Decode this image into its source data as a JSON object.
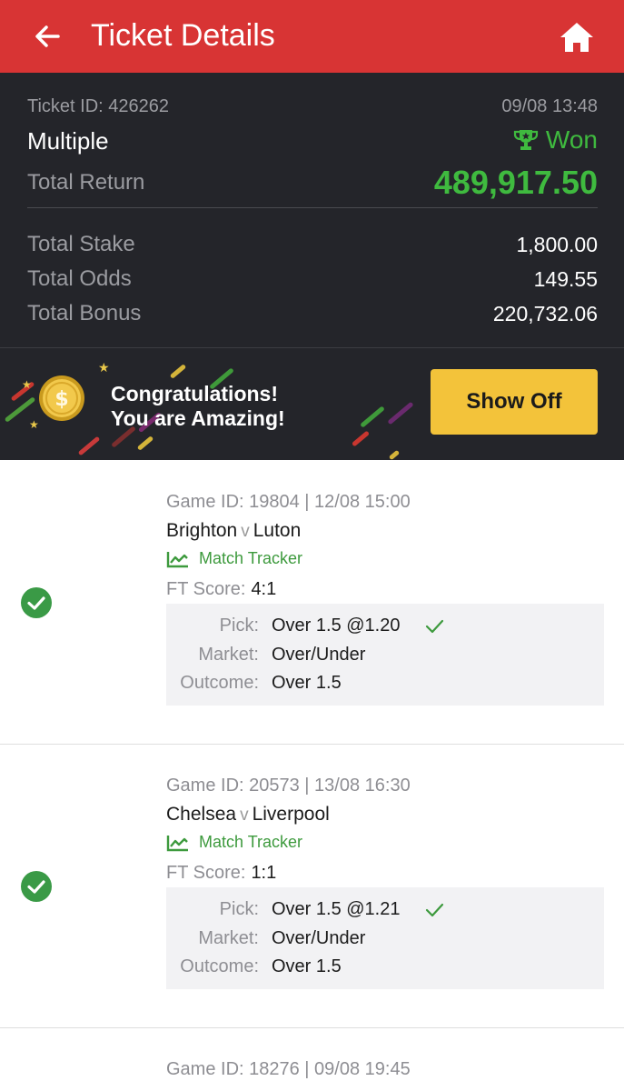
{
  "header": {
    "title": "Ticket Details",
    "back_icon": "arrow-left-icon",
    "home_icon": "home-icon",
    "color": "#d83434"
  },
  "summary": {
    "ticket_id": "Ticket ID: 426262",
    "datetime": "09/08 13:48",
    "bet_type": "Multiple",
    "status": "Won",
    "status_icon": "trophy-icon",
    "status_color": "#3fba3f",
    "total_return_label": "Total Return",
    "total_return_value": "489,917.50",
    "rows": [
      {
        "label": "Total Stake",
        "value": "1,800.00"
      },
      {
        "label": "Total Odds",
        "value": "149.55"
      },
      {
        "label": "Total Bonus",
        "value": "220,732.06"
      }
    ]
  },
  "promo": {
    "line1": "Congratulations!",
    "line2": "You are Amazing!",
    "button_label": "Show Off",
    "coin_icon": "coin-icon",
    "button_color": "#f3c33a"
  },
  "games": [
    {
      "game_id": "Game ID: 19804 | 12/08 15:00",
      "home": "Brighton",
      "vs": "v",
      "away": "Luton",
      "tracker_label": "Match Tracker",
      "score_label": "FT Score:",
      "score": "4:1",
      "pick_label": "Pick:",
      "pick": "Over 1.5 @1.20",
      "market_label": "Market:",
      "market": "Over/Under",
      "outcome_label": "Outcome:",
      "outcome": "Over 1.5"
    },
    {
      "game_id": "Game ID: 20573 | 13/08 16:30",
      "home": "Chelsea",
      "vs": "v",
      "away": "Liverpool",
      "tracker_label": "Match Tracker",
      "score_label": "FT Score:",
      "score": "1:1",
      "pick_label": "Pick:",
      "pick": "Over 1.5 @1.21",
      "market_label": "Market:",
      "market": "Over/Under",
      "outcome_label": "Outcome:",
      "outcome": "Over 1.5"
    },
    {
      "game_id": "Game ID: 18276 | 09/08 19:45"
    }
  ]
}
